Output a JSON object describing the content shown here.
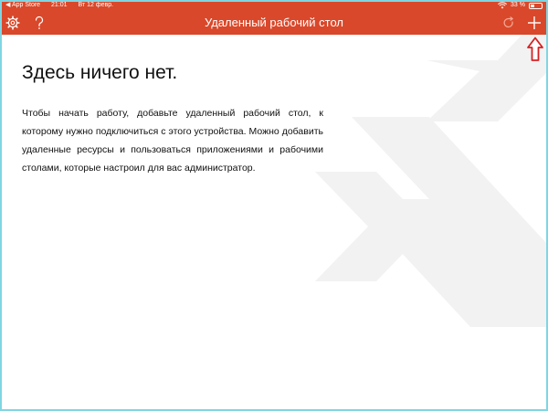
{
  "status_bar": {
    "back_app": "◀ App Store",
    "time": "21:01",
    "date": "Вт 12 февр.",
    "battery_percent": "33 %",
    "battery_level": 0.33
  },
  "nav": {
    "title": "Удаленный рабочий стол",
    "icons": {
      "left": [
        "gear-icon",
        "help-icon"
      ],
      "right": [
        "refresh-icon",
        "add-icon"
      ]
    }
  },
  "empty_state": {
    "title": "Здесь ничего нет.",
    "text": "Чтобы начать работу, добавьте удаленный рабочий стол, к которому нужно подключиться с этого устройства. Можно добавить удаленные ресурсы и пользоваться приложениями и рабочими столами, которые настроил для вас администратор."
  },
  "colors": {
    "header": "#d9482a",
    "watermark": "#f2f2f2",
    "annotation_arrow": "#d62020",
    "frame": "#7fd6e2"
  }
}
